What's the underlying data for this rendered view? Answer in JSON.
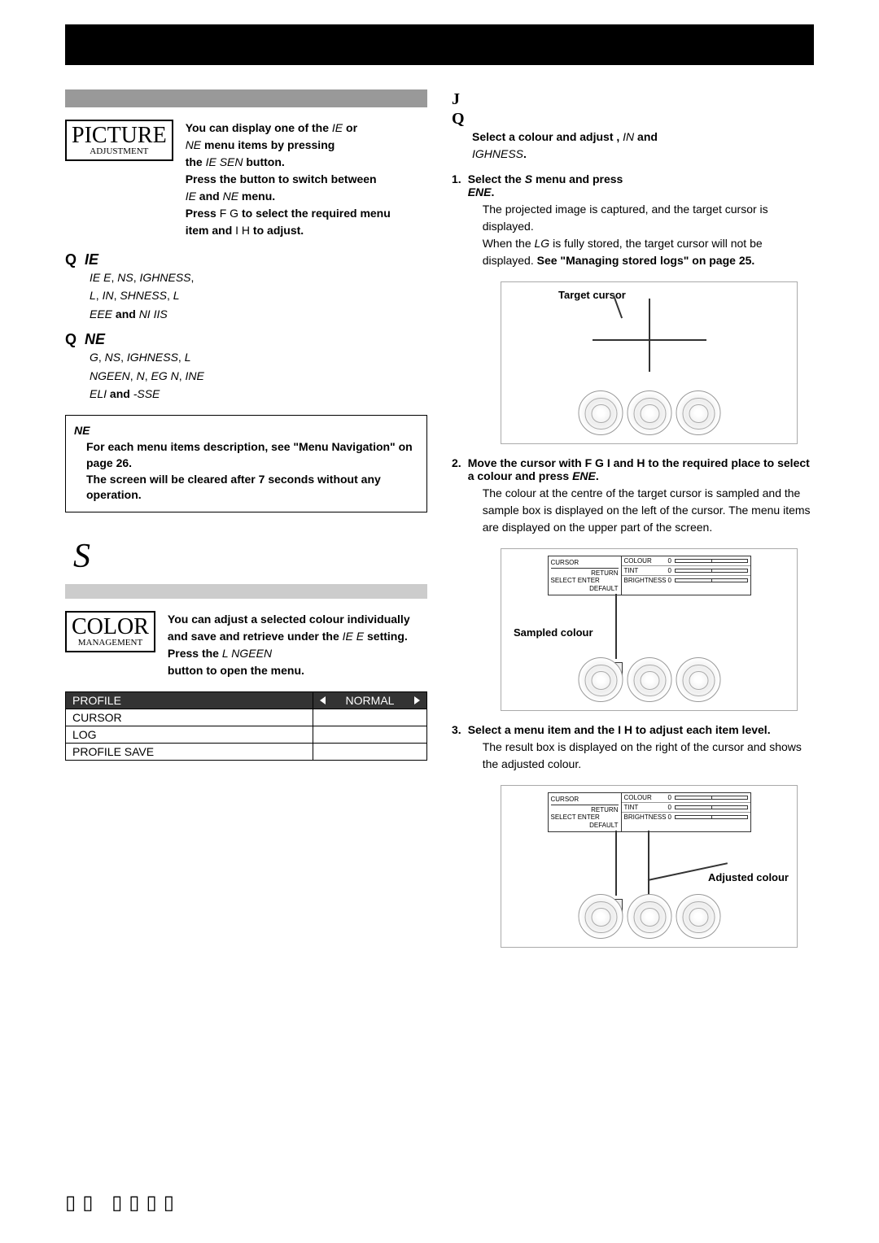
{
  "badges": {
    "picture": {
      "title": "PICTURE",
      "sub": "ADJUSTMENT"
    },
    "color": {
      "title": "COLOR",
      "sub": "MANAGEMENT"
    }
  },
  "pictureIntro": {
    "line1a": "You can display one of the ",
    "line1b": "IE",
    "line1c": " or ",
    "line2a": "NE",
    "line2b": " menu items by pressing ",
    "line3a": "the ",
    "line3b": "IE SEN",
    "line3c": " button. ",
    "line4": "Press the button to switch between ",
    "line5a": "IE",
    "line5b": " and ",
    "line5c": "NE",
    "line5d": " menu.",
    "line6a": "Press ",
    "line6b": "F G",
    "line6c": " to select the required menu ",
    "line7a": "item and ",
    "line7b": "I H",
    "line7c": " to adjust."
  },
  "items": {
    "ie": {
      "title": "IE",
      "parts": [
        "IE E",
        ", ",
        "NS",
        ", ",
        "IGHNESS",
        ", ",
        "L",
        ", ",
        "IN",
        ", ",
        "SHNESS",
        ", ",
        "L",
        " ",
        "EEE",
        " and ",
        "NI IIS"
      ]
    },
    "ne": {
      "title": "NE",
      "parts": [
        "G",
        ", ",
        "NS",
        ", ",
        "IGHNESS",
        ", ",
        "L",
        " ",
        "NGEEN",
        ", ",
        "N",
        ", ",
        "EG N",
        ", ",
        "INE",
        " ",
        "ELI",
        " and ",
        "-SSE"
      ]
    }
  },
  "note": {
    "title": "NE",
    "line1": "For each menu items description, see \"Menu Navigation\" on page 26.",
    "line2": "The screen will be cleared after 7 seconds without any operation."
  },
  "bigS": "S",
  "colorIntro": {
    "line1": "You can adjust a selected colour individually and save and retrieve under the ",
    "line2a": "IE E",
    "line2b": " setting. ",
    "line3a": "Press the ",
    "line3b": "L NGEEN",
    "line4": "button to open the menu."
  },
  "menuTable": {
    "rows": [
      {
        "left": "PROFILE",
        "right": "NORMAL",
        "header": true
      },
      {
        "left": "CURSOR",
        "right": "",
        "header": false
      },
      {
        "left": "LOG",
        "right": "",
        "header": false
      },
      {
        "left": "PROFILE SAVE",
        "right": "",
        "header": false
      }
    ]
  },
  "right": {
    "bigJ": "J",
    "bigQ": "Q",
    "intro": {
      "a": "Select a colour and adjust ",
      "b": ", ",
      "c": "IN",
      "d": " and ",
      "e": "IGHNESS",
      "f": "."
    },
    "steps": [
      {
        "num": "1.",
        "title_a": "Select the ",
        "title_b": "S",
        "title_c": " menu and press ",
        "title_d": "ENE",
        "title_e": ".",
        "body1": "The projected image is captured, and the target cursor is displayed.",
        "body2a": "When the ",
        "body2b": "LG",
        "body2c": " is fully stored, the target cursor will not be displayed. ",
        "body2d": "See \"Managing stored logs\" on page 25."
      },
      {
        "num": "2.",
        "title_a": "Move the cursor with ",
        "title_b": "F G I",
        "title_c": " and ",
        "title_d": "H",
        "title_e": " to the required place to select a colour and press ",
        "title_f": "ENE",
        "title_g": ".",
        "body1": "The colour at the centre of the target cursor is sampled and the sample box is displayed on the left of the cursor. The menu items are displayed on the upper part of the screen."
      },
      {
        "num": "3.",
        "title_a": "Select a menu item and the ",
        "title_b": "I H",
        "title_c": " to adjust each item level.",
        "body1": "The result box is displayed on the right of the cursor and shows the adjusted colour."
      }
    ],
    "labels": {
      "target": "Target cursor",
      "sampled": "Sampled colour",
      "adjusted": "Adjusted colour"
    },
    "miniPanel": {
      "cursor": "CURSOR",
      "return": "RETURN",
      "select": "SELECT",
      "enter": "ENTER",
      "default": "DEFAULT",
      "sliders": [
        "COLOUR",
        "TINT",
        "BRIGHTNESS"
      ],
      "zero": "0"
    }
  }
}
